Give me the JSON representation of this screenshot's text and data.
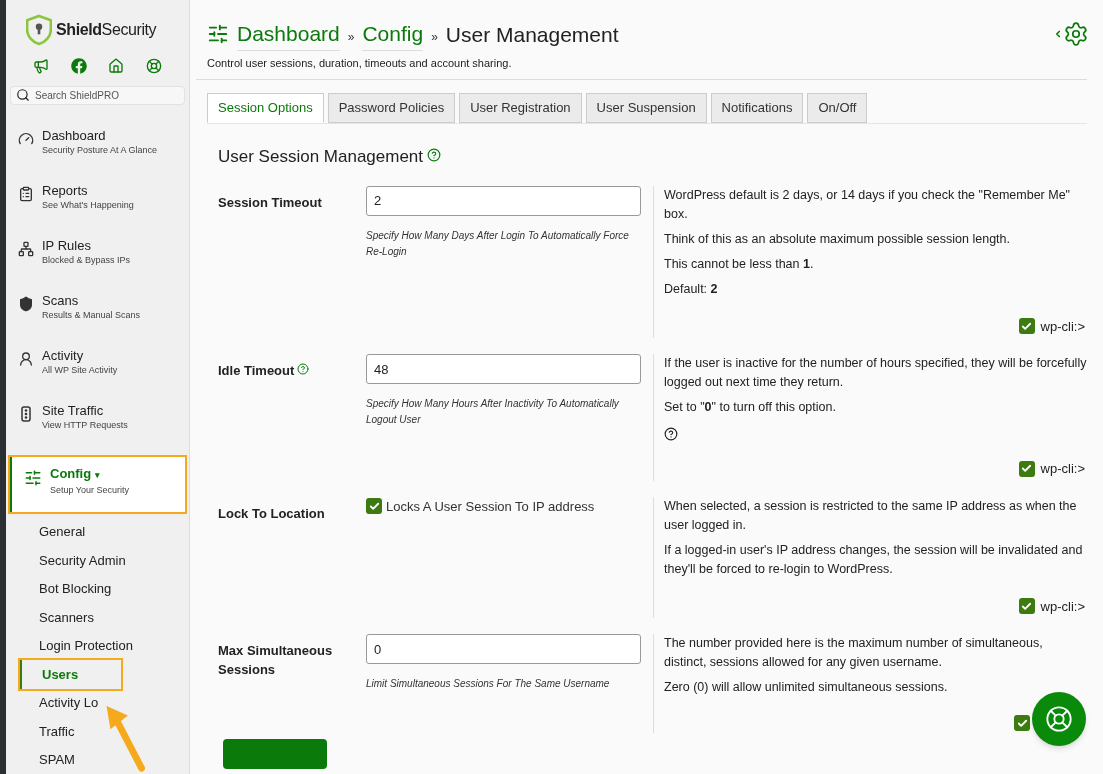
{
  "brand": {
    "name_bold": "Shield",
    "name_rest": "Security"
  },
  "search": {
    "placeholder": "Search ShieldPRO"
  },
  "nav": [
    {
      "kind": "gauge",
      "title": "Dashboard",
      "subtitle": "Security Posture At A Glance",
      "selected": false,
      "highlighted": false
    },
    {
      "kind": "report",
      "title": "Reports",
      "subtitle": "See What's Happening",
      "selected": false,
      "highlighted": false
    },
    {
      "kind": "network",
      "title": "IP Rules",
      "subtitle": "Blocked & Bypass IPs",
      "selected": false,
      "highlighted": false
    },
    {
      "kind": "shield",
      "title": "Scans",
      "subtitle": "Results & Manual Scans",
      "selected": false,
      "highlighted": false
    },
    {
      "kind": "activity",
      "title": "Activity",
      "subtitle": "All WP Site Activity",
      "selected": false,
      "highlighted": false
    },
    {
      "kind": "traffic",
      "title": "Site Traffic",
      "subtitle": "View HTTP Requests",
      "selected": false,
      "highlighted": false
    },
    {
      "kind": "sliders",
      "title": "Config",
      "subtitle": "Setup Your Security",
      "selected": true,
      "highlighted": true,
      "caret": "▾"
    }
  ],
  "submenu": [
    {
      "label": "General",
      "selected": false,
      "highlighted": false
    },
    {
      "label": "Security Admin",
      "selected": false,
      "highlighted": false
    },
    {
      "label": "Bot Blocking",
      "selected": false,
      "highlighted": false
    },
    {
      "label": "Scanners",
      "selected": false,
      "highlighted": false
    },
    {
      "label": "Login Protection",
      "selected": false,
      "highlighted": false
    },
    {
      "label": "Users",
      "selected": true,
      "highlighted": true
    },
    {
      "label": "Activity Lo",
      "selected": false,
      "highlighted": false
    },
    {
      "label": "Traffic",
      "selected": false,
      "highlighted": false
    },
    {
      "label": "SPAM",
      "selected": false,
      "highlighted": false
    }
  ],
  "breadcrumb": [
    {
      "label": "Dashboard",
      "kind": "link"
    },
    {
      "label": "Config",
      "kind": "link"
    },
    {
      "label": "User Management",
      "kind": "current"
    }
  ],
  "separator": "»",
  "subtitle": "Control user sessions, duration, timeouts and account sharing.",
  "tabs": [
    {
      "label": "Session Options",
      "selected": true
    },
    {
      "label": "Password Policies",
      "selected": false
    },
    {
      "label": "User Registration",
      "selected": false
    },
    {
      "label": "User Suspension",
      "selected": false
    },
    {
      "label": "Notifications",
      "selected": false
    },
    {
      "label": "On/Off",
      "selected": false
    }
  ],
  "section_title": "User Session Management",
  "options": [
    {
      "label": "Session Timeout",
      "kind": "text",
      "value": "2",
      "hint": "Specify How Many Days After Login To Automatically Force Re-Login",
      "description": [
        "WordPress default is 2 days, or 14 days if you check the \"Remember Me\" box.",
        "Think of this as an absolute maximum possible session length.",
        "This cannot be less than **1**.",
        "Default: **2**"
      ],
      "wp_cli": {
        "checked": true,
        "label": "wp-cli:>"
      }
    },
    {
      "label": "Idle Timeout",
      "has_help": true,
      "kind": "text",
      "value": "48",
      "hint": "Specify How Many Hours After Inactivity To Automatically Logout User",
      "description": [
        "If the user is inactive for the number of hours specified, they will be forcefully logged out next time they return.",
        "Set to \"**0**\" to turn off this option."
      ],
      "desc_help": true,
      "wp_cli": {
        "checked": true,
        "label": "wp-cli:>"
      }
    },
    {
      "label": "Lock To Location",
      "kind": "checkbox",
      "checked": true,
      "checkbox_label": "Locks A User Session To IP address",
      "description": [
        "When selected, a session is restricted to the same IP address as when the user logged in.",
        "If a logged-in user's IP address changes, the session will be invalidated and they'll be forced to re-login to WordPress."
      ],
      "wp_cli": {
        "checked": true,
        "label": "wp-cli:>"
      }
    },
    {
      "label": "Max Simultaneous Sessions",
      "kind": "text",
      "value": "0",
      "hint": "Limit Simultaneous Sessions For The Same Username",
      "description": [
        "The number provided here is the maximum number of simultaneous, distinct, sessions allowed for any given username.",
        "Zero (0) will allow unlimited simultaneous sessions."
      ],
      "wp_cli": {
        "checked": true
      }
    }
  ]
}
